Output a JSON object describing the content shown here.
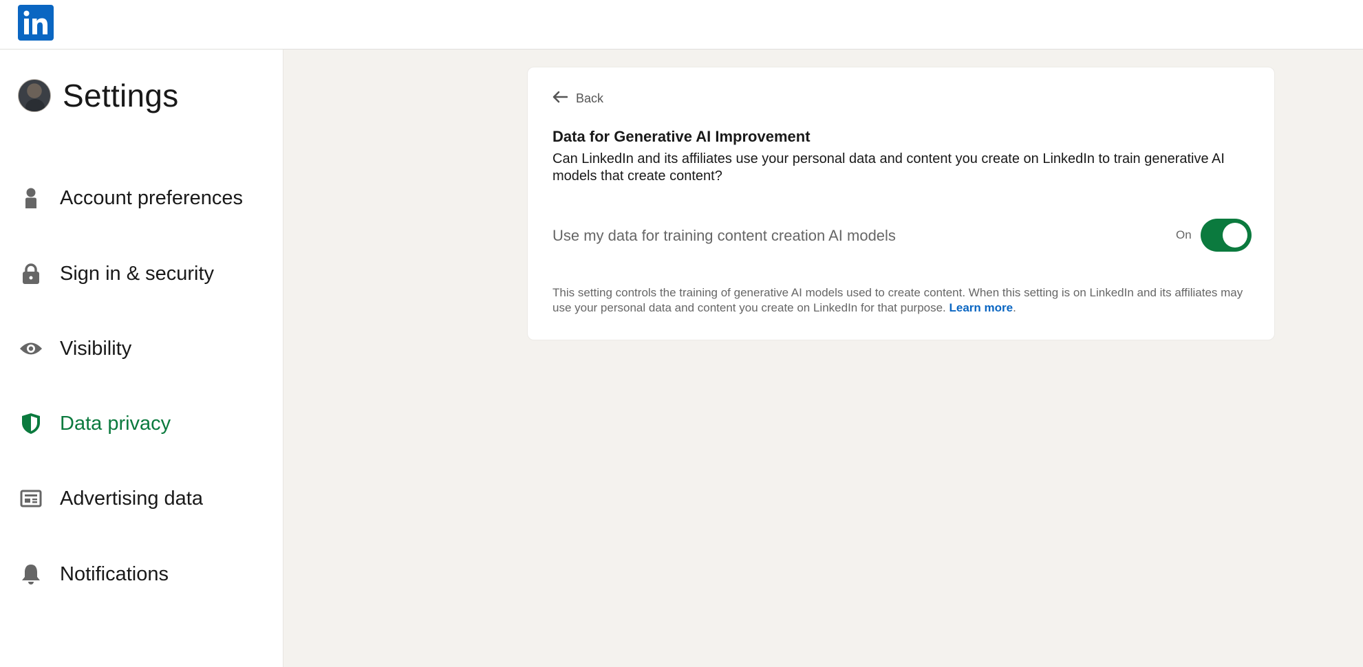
{
  "header": {
    "logo_text": "in"
  },
  "sidebar": {
    "title": "Settings",
    "items": [
      {
        "label": "Account preferences",
        "icon": "person-icon",
        "active": false
      },
      {
        "label": "Sign in & security",
        "icon": "lock-icon",
        "active": false
      },
      {
        "label": "Visibility",
        "icon": "eye-icon",
        "active": false
      },
      {
        "label": "Data privacy",
        "icon": "shield-icon",
        "active": true
      },
      {
        "label": "Advertising data",
        "icon": "ad-icon",
        "active": false
      },
      {
        "label": "Notifications",
        "icon": "bell-icon",
        "active": false
      }
    ]
  },
  "main": {
    "back_label": "Back",
    "title": "Data for Generative AI Improvement",
    "description": "Can LinkedIn and its affiliates use your personal data and content you create on LinkedIn to train generative AI models that create content?",
    "toggle": {
      "label": "Use my data for training content creation AI models",
      "state_label": "On",
      "on": true
    },
    "footnote": {
      "text": "This setting controls the training of generative AI models used to create content. When this setting is on LinkedIn and its affiliates may use your personal data and content you create on LinkedIn for that purpose.",
      "link_label": "Learn more",
      "suffix": "."
    }
  },
  "colors": {
    "brand": "#0a66c2",
    "accent_green": "#0b7a3e",
    "background": "#f4f2ee"
  }
}
